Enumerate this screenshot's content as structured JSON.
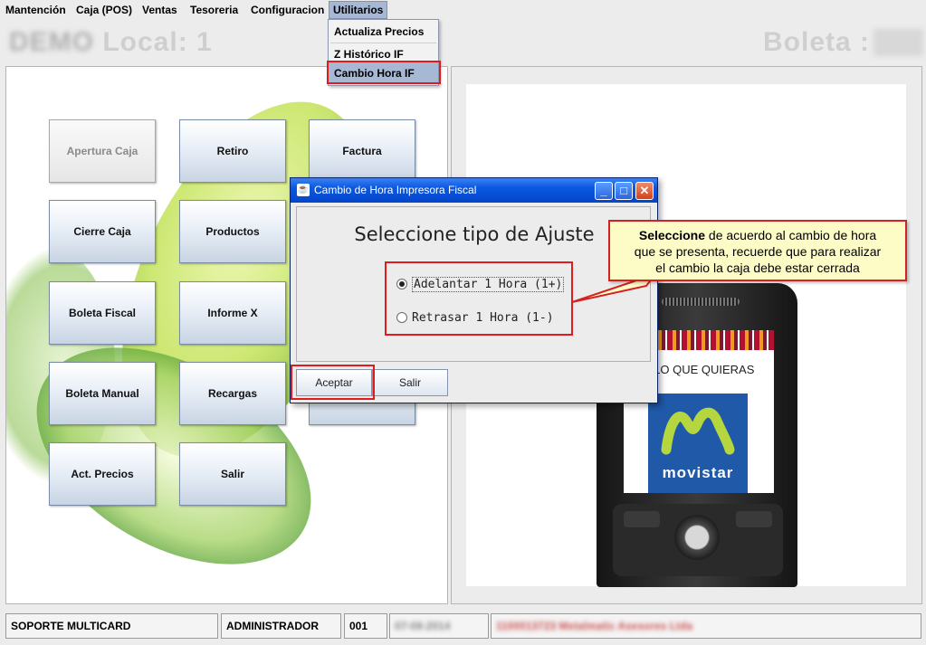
{
  "menu": [
    {
      "label": "Mantención"
    },
    {
      "label": "Caja (POS)"
    },
    {
      "label": "Ventas"
    },
    {
      "label": "Tesoreria"
    },
    {
      "label": "Configuracion"
    },
    {
      "label": "Utilitarios"
    }
  ],
  "dropdown": {
    "items": [
      {
        "label": "Actualiza Precios"
      },
      {
        "label": "Z Histórico IF"
      },
      {
        "label": "Cambio Hora IF"
      }
    ],
    "selected": "Cambio Hora IF"
  },
  "header": {
    "local_label": "Local:",
    "local_value": "1",
    "boleta_label": "Boleta :"
  },
  "buttons": [
    {
      "label": "Apertura Caja"
    },
    {
      "label": "Retiro"
    },
    {
      "label": "Factura"
    },
    {
      "label": "Cierre Caja"
    },
    {
      "label": "Productos"
    },
    {
      "label": "Boleta Fiscal"
    },
    {
      "label": "Informe X"
    },
    {
      "label": "Boleta Manual"
    },
    {
      "label": "Recargas"
    },
    {
      "label": "Act. Precios"
    },
    {
      "label": "Salir"
    }
  ],
  "ad": {
    "text": "A LO QUE QUIERAS",
    "brand": "movistar"
  },
  "dialog": {
    "title": "Cambio de Hora Impresora Fiscal",
    "heading": "Seleccione tipo de Ajuste",
    "option1": "Adelantar 1 Hora (1+)",
    "option2": "Retrasar 1 Hora (1-)",
    "selected": "option1",
    "accept": "Aceptar",
    "exit": "Salir"
  },
  "callout": {
    "bold": "Seleccione",
    "line1": " de acuerdo al cambio de hora",
    "line2": "que se presenta, recuerde que para realizar",
    "line3": "el cambio la caja debe estar cerrada"
  },
  "status": {
    "cell1": "SOPORTE MULTICARD",
    "cell2": "ADMINISTRADOR",
    "cell3": "001"
  },
  "colors": {
    "titlebar": "#0a58e0",
    "highlight": "#e01b1b",
    "callout_bg": "#fdfbc6",
    "menu_selected": "#a6b8d4"
  }
}
